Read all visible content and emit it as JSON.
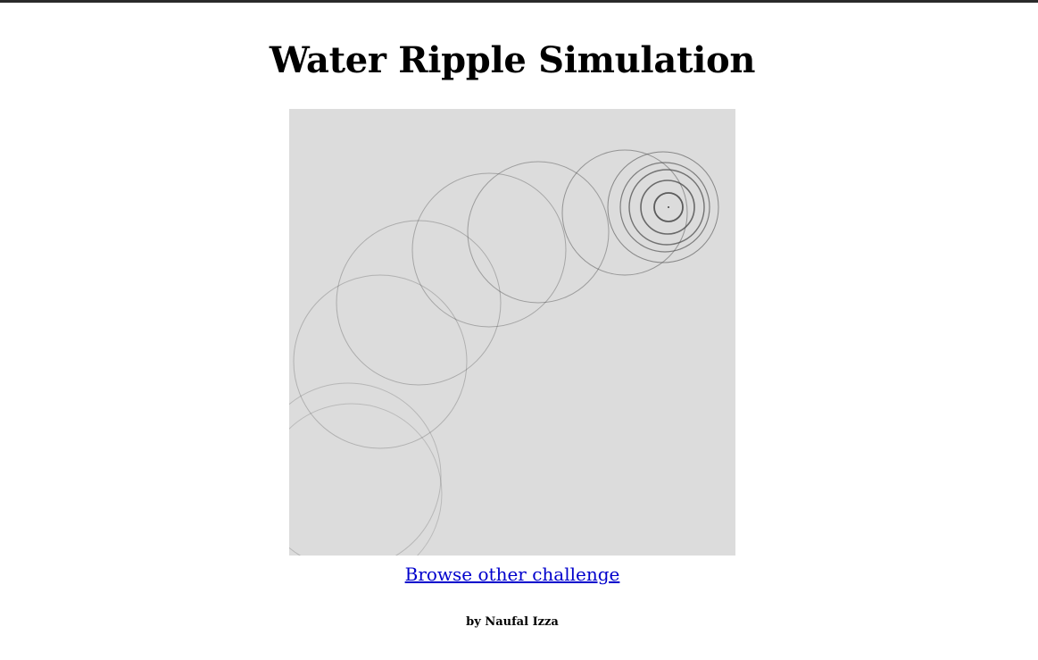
{
  "page": {
    "title": "Water Ripple Simulation",
    "browse_link": "Browse other challenge",
    "byline": "by Naufal Izza"
  },
  "canvas": {
    "background": "#dcdcdc",
    "ripple_color": "#444444"
  }
}
